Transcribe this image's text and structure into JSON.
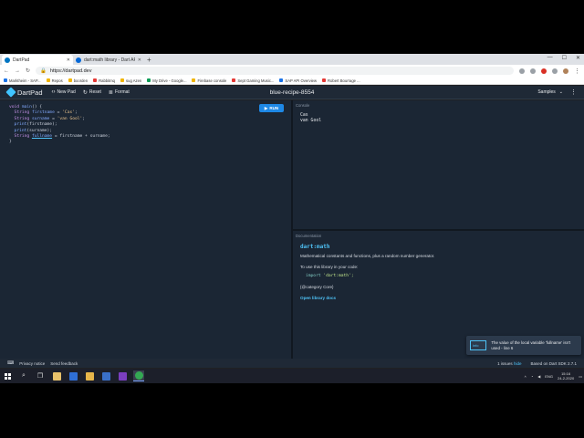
{
  "browser": {
    "tabs": [
      {
        "title": "DartPad",
        "active": true
      },
      {
        "title": "dart:math library - Dart API",
        "active": false
      }
    ],
    "url": "https://dartpad.dev",
    "bookmarks": [
      "Marktheim - SAP...",
      "Repos",
      "boorden",
      "Rabbitmq",
      "sug Azen",
      "My Drive - Google...",
      "Firebase console",
      "Sept Gaming Music...",
      "SAP API Overview",
      "Robert Bourrage ..."
    ]
  },
  "header": {
    "logo": "DartPad",
    "new_pad": "New Pad",
    "reset": "Reset",
    "format": "Format",
    "title": "blue-recipe-8554",
    "samples": "Samples"
  },
  "editor": {
    "run_label": "RUN",
    "code_lines": [
      "void main() {",
      "  String firstname = 'Cas';",
      "  String surname = 'van Gool';",
      "  print(firstname);",
      "  print(surname);",
      "  String fullname = firstname + surname;",
      "}"
    ]
  },
  "console": {
    "label": "Console",
    "output": "Cas\nvan Gool"
  },
  "docs": {
    "label": "Documentation",
    "title": "dart:math",
    "description": "Mathematical constants and functions, plus a random number generator.",
    "use_text": "To use this library in your code:",
    "import_keyword": "import",
    "import_string": "'dart:math';",
    "category": "{@category Core}",
    "link": "Open library docs"
  },
  "toast": {
    "badge": "info",
    "message": "The value of the local variable 'fullname' isn't used - line 6"
  },
  "footer": {
    "privacy": "Privacy notice",
    "feedback": "Send feedback",
    "issues": "1 issues",
    "info": "hide",
    "sdk": "Based on Dart SDK 2.7.1"
  },
  "taskbar": {
    "time": "15:16",
    "date": "24-2-2020",
    "lang": "ENG"
  }
}
